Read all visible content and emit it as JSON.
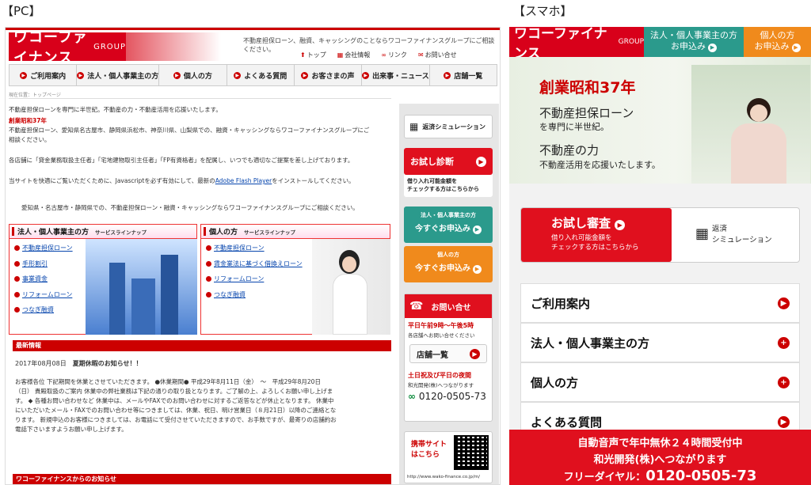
{
  "labels": {
    "pc": "【PC】",
    "smartphone": "【スマホ】"
  },
  "pc": {
    "logo": {
      "main": "ワコーファイナンス",
      "sub": "GROUP"
    },
    "tagline": "不動産担保ローン、融資、キャッシングのことならワコーファイナンスグループにご相談ください。",
    "toplinks": [
      "トップ",
      "会社情報",
      "リンク",
      "お問い合せ"
    ],
    "nav": [
      "ご利用案内",
      "法人・個人事業主の方",
      "個人の方",
      "よくある質問",
      "お客さまの声",
      "出来事・ニュース",
      "店舗一覧"
    ],
    "breadcrumb": "現在位置：トップページ",
    "intro1": "不動産担保ローンを専門に半世紀。不動産の力・不動産活用を応援いたします。",
    "intro_red": "創業昭和37年",
    "intro2": "不動産担保ローン、愛知県名古屋市、静岡県浜松市、神奈川県、山梨県での、融資・キャッシングならワコーファイナンスグループにご",
    "intro3": "相談ください。",
    "intro4": "各店舗に「貸金業務取扱主任者」「宅地建物取引主任者」「FP有資格者」を配属し、いつでも適切なご提案を差し上げております。",
    "intro5_pre": "当サイトを快適にご覧いただくために、Javascriptを必ず有効にして、最新の",
    "intro5_link": "Adobe Flash Player",
    "intro5_post": "をインストールしてください。",
    "intro6": "愛知県・名古屋市・静岡県での、不動産担保ローン・融資・キャッシングならワコーファイナンスグループにご相談ください。",
    "corp": {
      "title": "法人・個人事業主の方",
      "sub": "サービスラインナップ",
      "items": [
        "不動産担保ローン",
        "手形割引",
        "事業資金",
        "リフォームローン",
        "つなぎ融資"
      ]
    },
    "personal": {
      "title": "個人の方",
      "sub": "サービスラインナップ",
      "items": [
        "不動産担保ローン",
        "賃金業法に基づく借換えローン",
        "リフォームローン",
        "つなぎ融資"
      ]
    },
    "news": {
      "header": "最新情報",
      "date": "2017年08月08日",
      "title": "夏期休暇のお知らせ！！",
      "lines": [
        "お客様各位 下記期間を休業とさせていただきます。 ●休業期間● 平成29年8月11日（金）　～　平成29年8月20日",
        "（日） 貴殿取扱のご案内 休業中の弊社業務は下記の通りの取り扱となります。ご了解の上、よろしくお願い申し上げま",
        "す。 ◆ 各種お問い合わせなど 休業中は、メールやFAXでのお問い合わせに対するご返答などが休止となります。 休業中",
        "にいただいたメール・FAXでのお問い合わせ等につきましては、休業、祝日、明け営業日（８月21日）以降のご連絡とな",
        "ります。 新規申込のお客様につきましては、お電話にて受付させていただきますので、お手数ですが、最寄りの店舗約お",
        "電話下さいますようお願い申し上げます。"
      ],
      "footer_header": "ワコーファイナンスからのお知らせ"
    },
    "sidebar": {
      "sim": "返済シミュレーション",
      "trial": "お試し診断",
      "trial_sub1": "借り入れ可能金額を",
      "trial_sub2": "チェックする方はこちらから",
      "corp_apply_top": "法人・個人事業主の方",
      "corp_apply": "今すぐお申込み",
      "person_apply_top": "個人の方",
      "person_apply": "今すぐお申込み",
      "contact": "お問い合せ",
      "hours": "平日午前9時～午後5時",
      "hours_sub": "各店舗へお問い合せください",
      "stores": "店舗一覧",
      "night": "土日祝及び平日の夜間",
      "night_sub": "和光開発(株)へつながります",
      "phone": "0120-0505-73",
      "mobile": "携帯サイト\nはこちら",
      "url": "http://www.wako-finance.co.jp/m/"
    }
  },
  "sp": {
    "logo": {
      "main": "ワコーファイナンス",
      "sub": "GROUP"
    },
    "corp_top": "法人・個人事業主の方",
    "corp_apply": "お申込み",
    "person_top": "個人の方",
    "person_apply": "お申込み",
    "hero": {
      "founded": "創業昭和37年",
      "l1": "不動産担保ローン",
      "l2": "を専門に半世紀。",
      "l3": "不動産の力",
      "l4": "不動産活用を応援いたします。"
    },
    "trial": "お試し審査",
    "trial_sub1": "借り入れ可能金額を",
    "trial_sub2": "チェックする方はこちらから",
    "sim1": "返済",
    "sim2": "シミュレーション",
    "menu": [
      "ご利用案内",
      "法人・個人事業主の方",
      "個人の方",
      "よくある質問"
    ],
    "banner1": "自動音声で年中無休２４時間受付中",
    "banner2": "和光開発(株)へつながります",
    "banner3_label": "フリーダイヤル：",
    "banner3_num": "0120-0505-73"
  }
}
